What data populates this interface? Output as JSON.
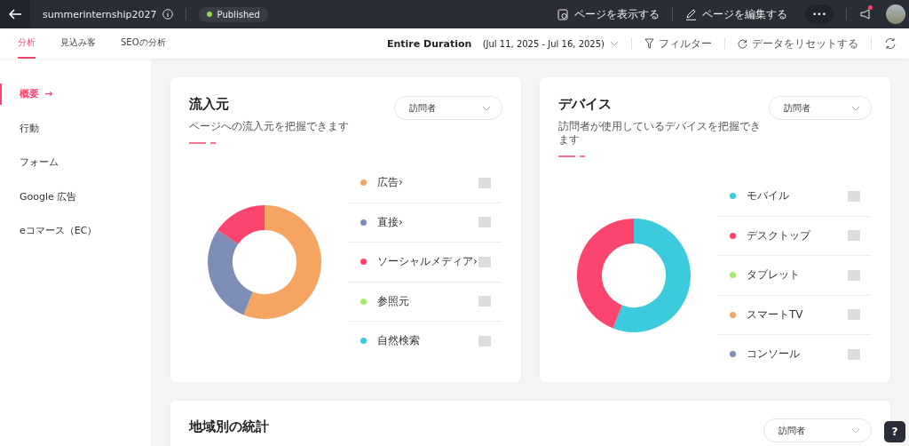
{
  "topbar": {
    "title": "summerinternship2027",
    "status": "Published",
    "actions": [
      {
        "label": "ページを表示する",
        "kind": "view"
      },
      {
        "label": "ページを編集する",
        "kind": "edit"
      }
    ],
    "more": "•••",
    "notification": true
  },
  "tabs": [
    {
      "label": "分析",
      "selected": true
    },
    {
      "label": "見込み客",
      "selected": false
    },
    {
      "label": "SEOの分析",
      "selected": false
    }
  ],
  "toolbar": {
    "duration": "Entire Duration",
    "range": "(Jul 11, 2025 - Jul 16, 2025)",
    "filter": "フィルター",
    "reset": "データをリセットする"
  },
  "sidebar": [
    {
      "label": "概要",
      "selected": true,
      "arrow": "→"
    },
    {
      "label": "行動",
      "selected": false
    },
    {
      "label": "フォーム",
      "selected": false
    },
    {
      "label": "Google 広告",
      "selected": false
    },
    {
      "label": "eコマース（EC）",
      "selected": false
    }
  ],
  "cards": [
    {
      "title": "流入元",
      "subtitle": "ページへの流入元を把握できます",
      "dropdown": "訪問者",
      "kind": "sources",
      "legend": [
        {
          "label": "広告",
          "color": "#f5a462",
          "chevron": "›"
        },
        {
          "label": "直接",
          "color": "#7d8db5",
          "chevron": "›"
        },
        {
          "label": "ソーシャルメディア",
          "color": "#fb456e",
          "chevron": "›"
        },
        {
          "label": "参照元",
          "color": "#a6e86a"
        },
        {
          "label": "自然検索",
          "color": "#3ccbdc"
        }
      ]
    },
    {
      "title": "デバイス",
      "subtitle": "訪問者が使用しているデバイスを把握できます",
      "dropdown": "訪問者",
      "kind": "devices",
      "legend": [
        {
          "label": "モバイル",
          "color": "#3ccbdc"
        },
        {
          "label": "デスクトップ",
          "color": "#fb456e"
        },
        {
          "label": "タブレット",
          "color": "#a6e86a"
        },
        {
          "label": "スマートTV",
          "color": "#f5a462"
        },
        {
          "label": "コンソール",
          "color": "#7d8db5"
        }
      ]
    }
  ],
  "region_card": {
    "title": "地域別の統計",
    "dropdown": "訪問者"
  },
  "help": "?"
}
